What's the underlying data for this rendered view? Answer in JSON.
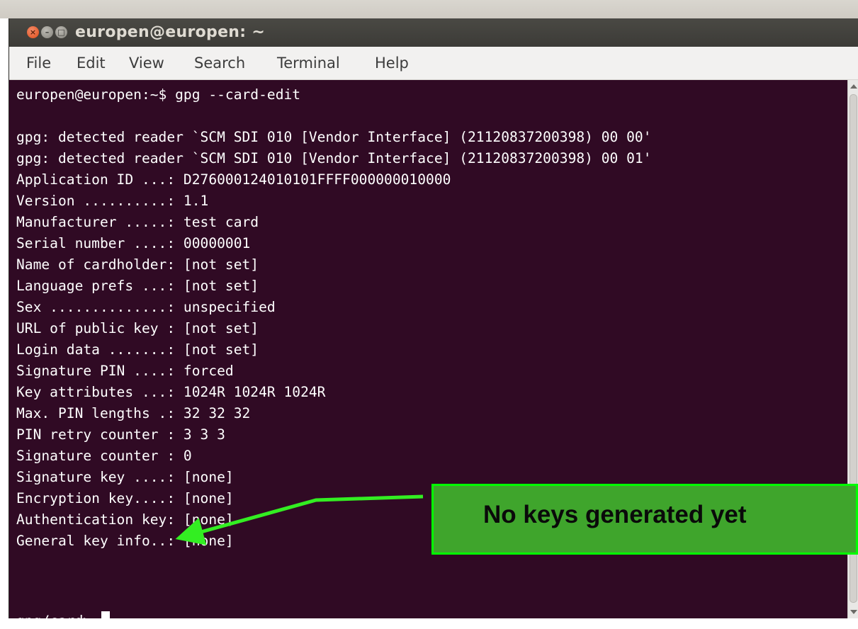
{
  "window": {
    "title": "europen@europen: ~",
    "buttons": {
      "close_glyph": "×",
      "minimize_glyph": "–",
      "maximize_glyph": "□"
    }
  },
  "menu": [
    "File",
    "Edit",
    "View",
    "Search",
    "Terminal",
    "Help"
  ],
  "terminal": {
    "lines": [
      "europen@europen:~$ gpg --card-edit",
      "",
      "gpg: detected reader `SCM SDI 010 [Vendor Interface] (21120837200398) 00 00'",
      "gpg: detected reader `SCM SDI 010 [Vendor Interface] (21120837200398) 00 01'",
      "Application ID ...: D276000124010101FFFF000000010000",
      "Version ..........: 1.1",
      "Manufacturer .....: test card",
      "Serial number ....: 00000001",
      "Name of cardholder: [not set]",
      "Language prefs ...: [not set]",
      "Sex ..............: unspecified",
      "URL of public key : [not set]",
      "Login data .......: [not set]",
      "Signature PIN ....: forced",
      "Key attributes ...: 1024R 1024R 1024R",
      "Max. PIN lengths .: 32 32 32",
      "PIN retry counter : 3 3 3",
      "Signature counter : 0",
      "Signature key ....: [none]",
      "Encryption key....: [none]",
      "Authentication key: [none]",
      "General key info..: [none]",
      ""
    ],
    "prompt": "gpg/card> "
  },
  "annotation": {
    "text": "No keys generated yet",
    "fill_color": "#3fa52c",
    "border_color": "#00ff00"
  },
  "colors": {
    "terminal_bg": "#300a24",
    "terminal_fg": "#ffffff",
    "titlebar": "#3c3b37",
    "menubar": "#f2f1f0"
  }
}
